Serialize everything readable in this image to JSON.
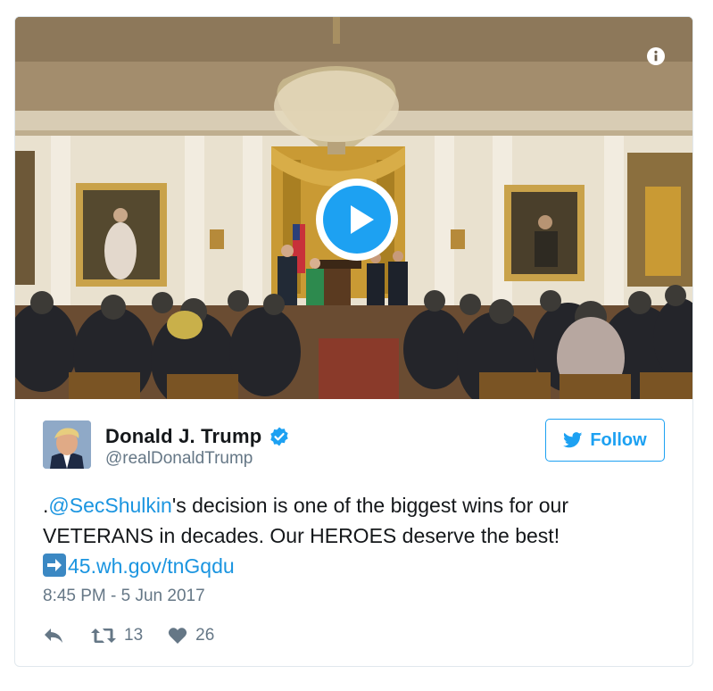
{
  "media": {
    "play_label": "Play video",
    "info_label": "Info"
  },
  "author": {
    "display_name": "Donald J. Trump",
    "handle": "@realDonaldTrump",
    "verified": true
  },
  "follow_button": {
    "label": "Follow"
  },
  "tweet": {
    "prefix": ".",
    "mention": "@SecShulkin",
    "text_after_mention": "'s decision is one of the biggest wins for our VETERANS in decades. Our HEROES deserve the best!",
    "emoji": "arrow-right-emoji",
    "link": "45.wh.gov/tnGqdu"
  },
  "timestamp": "8:45 PM - 5 Jun 2017",
  "actions": {
    "reply_icon": "reply-icon",
    "retweet_count": "13",
    "like_count": "26"
  },
  "colors": {
    "accent": "#1da1f2",
    "link": "#1b95e0",
    "muted": "#657786"
  }
}
